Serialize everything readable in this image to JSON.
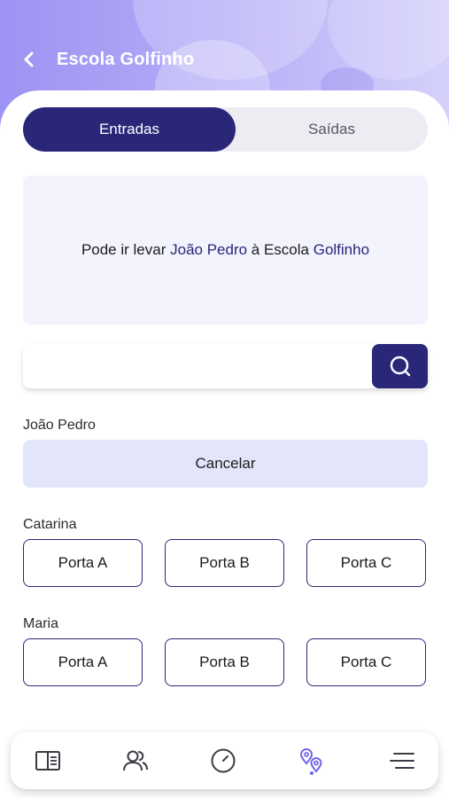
{
  "header": {
    "title": "Escola Golfinho",
    "back_icon": "chevron-left-icon"
  },
  "tabs": [
    {
      "label": "Entradas",
      "active": true
    },
    {
      "label": "Saídas",
      "active": false
    }
  ],
  "info": {
    "prefix": "Pode ir levar ",
    "child": "João Pedro",
    "middle": " à Escola ",
    "school": "Golfinho"
  },
  "search": {
    "value": "",
    "placeholder": "",
    "icon": "search-icon"
  },
  "groups": [
    {
      "name": "João Pedro",
      "action": "Cancelar"
    },
    {
      "name": "Catarina",
      "doors": [
        "Porta A",
        "Porta B",
        "Porta C"
      ]
    },
    {
      "name": "Maria",
      "doors": [
        "Porta A",
        "Porta B",
        "Porta C"
      ]
    }
  ],
  "nav": {
    "items": [
      {
        "icon": "book-icon",
        "active": false
      },
      {
        "icon": "users-icon",
        "active": false
      },
      {
        "icon": "gauge-icon",
        "active": false
      },
      {
        "icon": "location-pins-icon",
        "active": true
      },
      {
        "icon": "menu-icon",
        "active": false
      }
    ]
  },
  "colors": {
    "primary": "#2a2778",
    "accent": "#7166e8",
    "header_gradient_start": "#9d93f3",
    "info_bg": "#f2f3fd",
    "cancel_bg": "#e3e6fb"
  }
}
